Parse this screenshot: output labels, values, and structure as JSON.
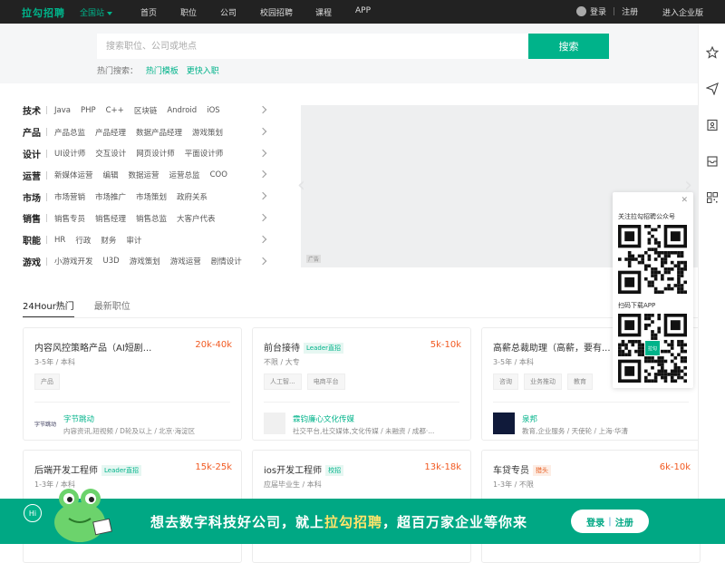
{
  "topbar": {
    "logo": "拉勾招聘",
    "city": "全国站",
    "nav": [
      "首页",
      "职位",
      "公司",
      "校园招聘",
      "课程",
      "APP"
    ],
    "login": "登录",
    "register": "注册",
    "enterprise": "进入企业版"
  },
  "search": {
    "placeholder": "搜索职位、公司或地点",
    "button": "搜索",
    "hot_label": "热门搜索：",
    "hot_keywords": [
      "热门模板",
      "更快入职"
    ]
  },
  "categories": [
    {
      "name": "技术",
      "items": [
        "Java",
        "PHP",
        "C++",
        "区块链",
        "Android",
        "iOS"
      ]
    },
    {
      "name": "产品",
      "items": [
        "产品总监",
        "产品经理",
        "数据产品经理",
        "游戏策划"
      ]
    },
    {
      "name": "设计",
      "items": [
        "UI设计师",
        "交互设计",
        "网页设计师",
        "平面设计师"
      ]
    },
    {
      "name": "运营",
      "items": [
        "新媒体运营",
        "编辑",
        "数据运营",
        "运营总监",
        "COO"
      ]
    },
    {
      "name": "市场",
      "items": [
        "市场营销",
        "市场推广",
        "市场策划",
        "政府关系"
      ]
    },
    {
      "name": "销售",
      "items": [
        "销售专员",
        "销售经理",
        "销售总监",
        "大客户代表"
      ]
    },
    {
      "name": "职能",
      "items": [
        "HR",
        "行政",
        "财务",
        "审计"
      ]
    },
    {
      "name": "游戏",
      "items": [
        "小游戏开发",
        "U3D",
        "游戏策划",
        "游戏运营",
        "剧情设计"
      ]
    }
  ],
  "banner": {
    "ad_label": "广告"
  },
  "tabs": [
    "24Hour热门",
    "最新职位"
  ],
  "jobs": [
    {
      "title": "内容风控策略产品（AI短剧...",
      "tag": "",
      "salary": "20k-40k",
      "req": "3-5年 / 本科",
      "labels": [
        "产品"
      ],
      "company": "字节跳动",
      "company_info": "内容资讯,短视频 / D轮及以上 / 北京·海淀区",
      "logo_text": "字节跳动"
    },
    {
      "title": "前台接待",
      "tag": "Leader直招",
      "salary": "5k-10k",
      "req": "不限 / 大专",
      "labels": [
        "人工智...",
        "电商平台"
      ],
      "company": "霖钧廉心文化传媒",
      "company_info": "社交平台,社交媒体,文化传媒 / 未融资 / 成都·...",
      "logo_text": ""
    },
    {
      "title": "高薪总裁助理（高薪，要有...",
      "tag": "",
      "salary": "",
      "req": "3-5年 / 本科",
      "labels": [
        "咨询",
        "业务推动",
        "教育"
      ],
      "company": "泉邦",
      "company_info": "教育,企业服务 / 天使轮 / 上海·华漕",
      "logo_text": ""
    },
    {
      "title": "后端开发工程师",
      "tag": "Leader直招",
      "salary": "15k-25k",
      "req": "1-3年 / 本科",
      "labels": [],
      "company": "",
      "company_info": "",
      "logo_text": ""
    },
    {
      "title": "ios开发工程师",
      "tag": "校招",
      "salary": "13k-18k",
      "req": "应届毕业生 / 本科",
      "labels": [],
      "company": "",
      "company_info": "",
      "logo_text": ""
    },
    {
      "title": "车贷专员",
      "tag": "猎头",
      "salary": "6k-10k",
      "req": "1-3年 / 不限",
      "labels": [],
      "company": "",
      "company_info": "",
      "logo_text": ""
    }
  ],
  "qr_popup": {
    "follow_text": "关注拉勾招聘公众号",
    "download_text": "扫码下载APP",
    "app_logo": "拉勾"
  },
  "bottom_banner": {
    "slogan_a": "想去数字科技好公司，就上",
    "slogan_brand": "拉勾招聘",
    "slogan_b": "，超百万家企业等你来",
    "login": "登录",
    "register": "注册",
    "hi": "Hi"
  },
  "colors": {
    "accent": "#00b38a",
    "salary": "#f15a22",
    "topbar": "#222222",
    "bottom": "#00a884"
  }
}
